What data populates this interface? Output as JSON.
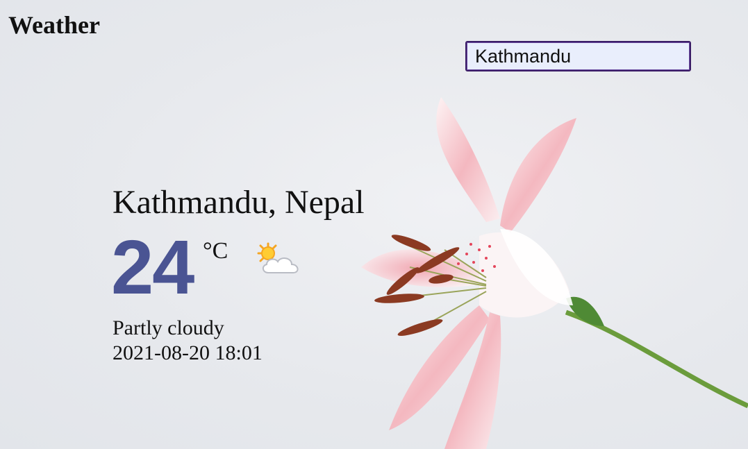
{
  "app": {
    "title": "Weather"
  },
  "search": {
    "value": "Kathmandu"
  },
  "weather": {
    "location": "Kathmandu, Nepal",
    "temperature": "24",
    "unit": "°C",
    "icon": "partly-cloudy-icon",
    "condition": "Partly cloudy",
    "datetime": "2021-08-20 18:01"
  },
  "colors": {
    "temperature": "#4a5493",
    "background": "#e7e9ed",
    "input_border": "#3a1c66",
    "input_background": "#e9eefc"
  }
}
